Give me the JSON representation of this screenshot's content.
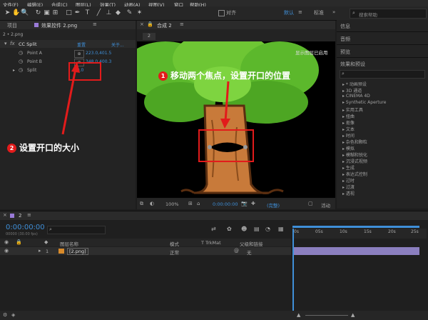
{
  "menu": [
    "文件(F)",
    "编辑(E)",
    "合成(C)",
    "图层(L)",
    "效果(T)",
    "动画(A)",
    "视图(V)",
    "窗口",
    "帮助(H)"
  ],
  "toolbar": {
    "align_label": "对齐",
    "default_label": "默认",
    "workspace_label": "标准",
    "search_placeholder": "搜索帮助"
  },
  "left_panel": {
    "tab_project": "项目",
    "tab_effects": "效果控件 2.png",
    "breadcrumb": "2 • 2.png",
    "effect_name": "CC Split",
    "reset_label": "重置",
    "about_label": "关于...",
    "props": [
      {
        "name": "Point A",
        "value": "223.0,401.5"
      },
      {
        "name": "Point B",
        "value": "348.0,400.3"
      },
      {
        "name": "Split",
        "value": "40.0"
      }
    ]
  },
  "comp": {
    "tab_label": "合成 2",
    "layer_tab": "2",
    "overlay_text": "显示图层已启用",
    "zoom": "100%",
    "timecode": "0:00:00:00",
    "quality": "(完整)",
    "active_camera": "活动"
  },
  "right_panel": {
    "items": [
      "信息",
      "音频",
      "预览",
      "效果和预设"
    ],
    "effects": [
      "* 动画预设",
      "3D 通道",
      "CINEMA 4D",
      "Synthetic Aperture",
      "实用工具",
      "扭曲",
      "抠像",
      "文本",
      "时间",
      "杂色和颗粒",
      "模拟",
      "模糊和锐化",
      "沉浸式视频",
      "生成",
      "表达式控制",
      "过时",
      "过渡",
      "透视"
    ]
  },
  "annotations": {
    "one": {
      "num": "1",
      "text": "移动两个焦点，设置开口的位置"
    },
    "two": {
      "num": "2",
      "text": "设置开口的大小"
    }
  },
  "timeline": {
    "comp_tab": "2",
    "timecode": "0:00:00:00",
    "frames": "00000 (30.00 fps)",
    "col_layer_name": "图层名称",
    "col_mode": "模式",
    "col_trkmat": "T TrkMat",
    "col_parent": "父级和链接",
    "layer_num": "1",
    "layer_name": "[2.png]",
    "layer_mode": "正常",
    "layer_parent": "无",
    "ruler": [
      "0s",
      "05s",
      "10s",
      "15s",
      "20s",
      "25s"
    ]
  }
}
